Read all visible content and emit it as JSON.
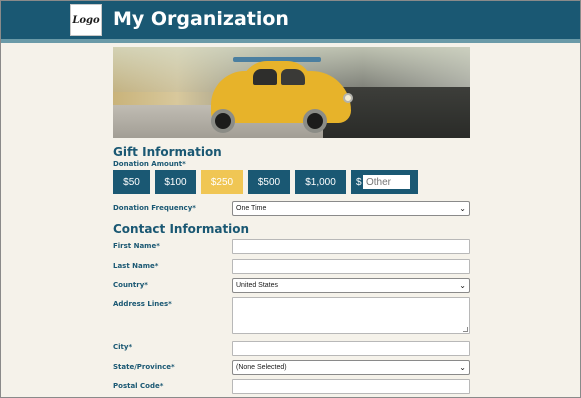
{
  "header": {
    "logo_text": "Logo",
    "org_name": "My Organization"
  },
  "colors": {
    "brand": "#1a5873",
    "accent_selected": "#f0c654",
    "background": "#f5f2ea"
  },
  "hero": {
    "image": "photo-yellow-toy-beetle-car"
  },
  "gift": {
    "section_title": "Gift Information",
    "amount_label": "Donation Amount*",
    "amounts": [
      "$50",
      "$100",
      "$250",
      "$500",
      "$1,000"
    ],
    "selected_amount": "$250",
    "other_prefix": "$",
    "other_placeholder": "Other",
    "frequency_label": "Donation Frequency*",
    "frequency_value": "One Time"
  },
  "contact": {
    "section_title": "Contact Information",
    "first_name_label": "First Name*",
    "last_name_label": "Last Name*",
    "country_label": "Country*",
    "country_value": "United States",
    "address_label": "Address Lines*",
    "city_label": "City*",
    "state_label": "State/Province*",
    "state_value": "(None Selected)",
    "postal_label": "Postal Code*"
  },
  "icons": {
    "select_chevron": "chevron-down-icon"
  }
}
